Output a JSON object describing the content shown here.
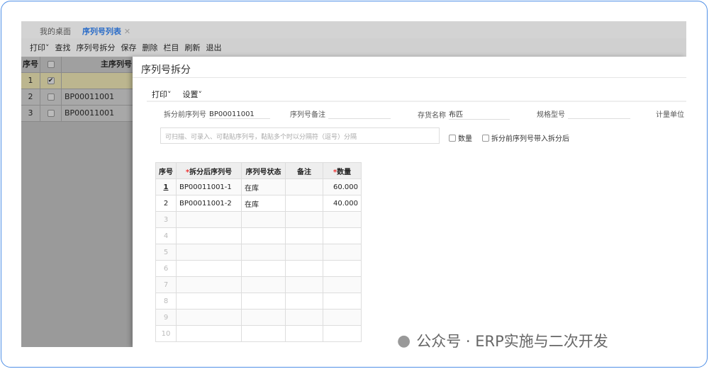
{
  "tabs": [
    {
      "label": "我的桌面"
    },
    {
      "label": "序列号列表",
      "active": true
    }
  ],
  "toolbar": [
    "打印",
    "查找",
    "序列号拆分",
    "保存",
    "删除",
    "栏目",
    "刷新",
    "退出"
  ],
  "list": {
    "headers": [
      "序号",
      "主序列号"
    ],
    "rows": [
      {
        "no": "1",
        "checked": true,
        "serial": ""
      },
      {
        "no": "2",
        "checked": false,
        "serial": "BP00011001"
      },
      {
        "no": "3",
        "checked": false,
        "serial": "BP00011001"
      }
    ]
  },
  "dialog": {
    "title": "序列号拆分",
    "toolbar": [
      "打印",
      "设置"
    ],
    "fields": {
      "pre_serial_label": "拆分前序列号",
      "pre_serial": "BP00011001",
      "remark_label": "序列号备注",
      "remark": "",
      "inv_name_label": "存货名称",
      "inv_name": "布匹",
      "spec_label": "规格型号",
      "spec": "",
      "unit_label": "计量单位"
    },
    "input_placeholder": "可扫描、可录入、可黏贴序列号，黏贴多个时以分隔符（逗号）分隔",
    "options": [
      {
        "label": "数量",
        "checked": false
      },
      {
        "label": "拆分前序列号带入拆分后",
        "checked": false
      }
    ],
    "grid": {
      "headers": [
        "序号",
        "拆分后序列号",
        "序列号状态",
        "备注",
        "数量"
      ],
      "rows": [
        [
          "1",
          "BP00011001-1",
          "在库",
          "",
          "60.000"
        ],
        [
          "2",
          "BP00011001-2",
          "在库",
          "",
          "40.000"
        ],
        [
          "3",
          "",
          "",
          "",
          ""
        ],
        [
          "4",
          "",
          "",
          "",
          ""
        ],
        [
          "5",
          "",
          "",
          "",
          ""
        ],
        [
          "6",
          "",
          "",
          "",
          ""
        ],
        [
          "7",
          "",
          "",
          "",
          ""
        ],
        [
          "8",
          "",
          "",
          "",
          ""
        ],
        [
          "9",
          "",
          "",
          "",
          ""
        ],
        [
          "10",
          "",
          "",
          "",
          ""
        ]
      ]
    }
  },
  "watermark": "公众号 · ERP实施与二次开发",
  "colors": {
    "accent": "#2a6cc8",
    "selected_row": "#fdf6d2",
    "frame": "#4f8fe6"
  }
}
